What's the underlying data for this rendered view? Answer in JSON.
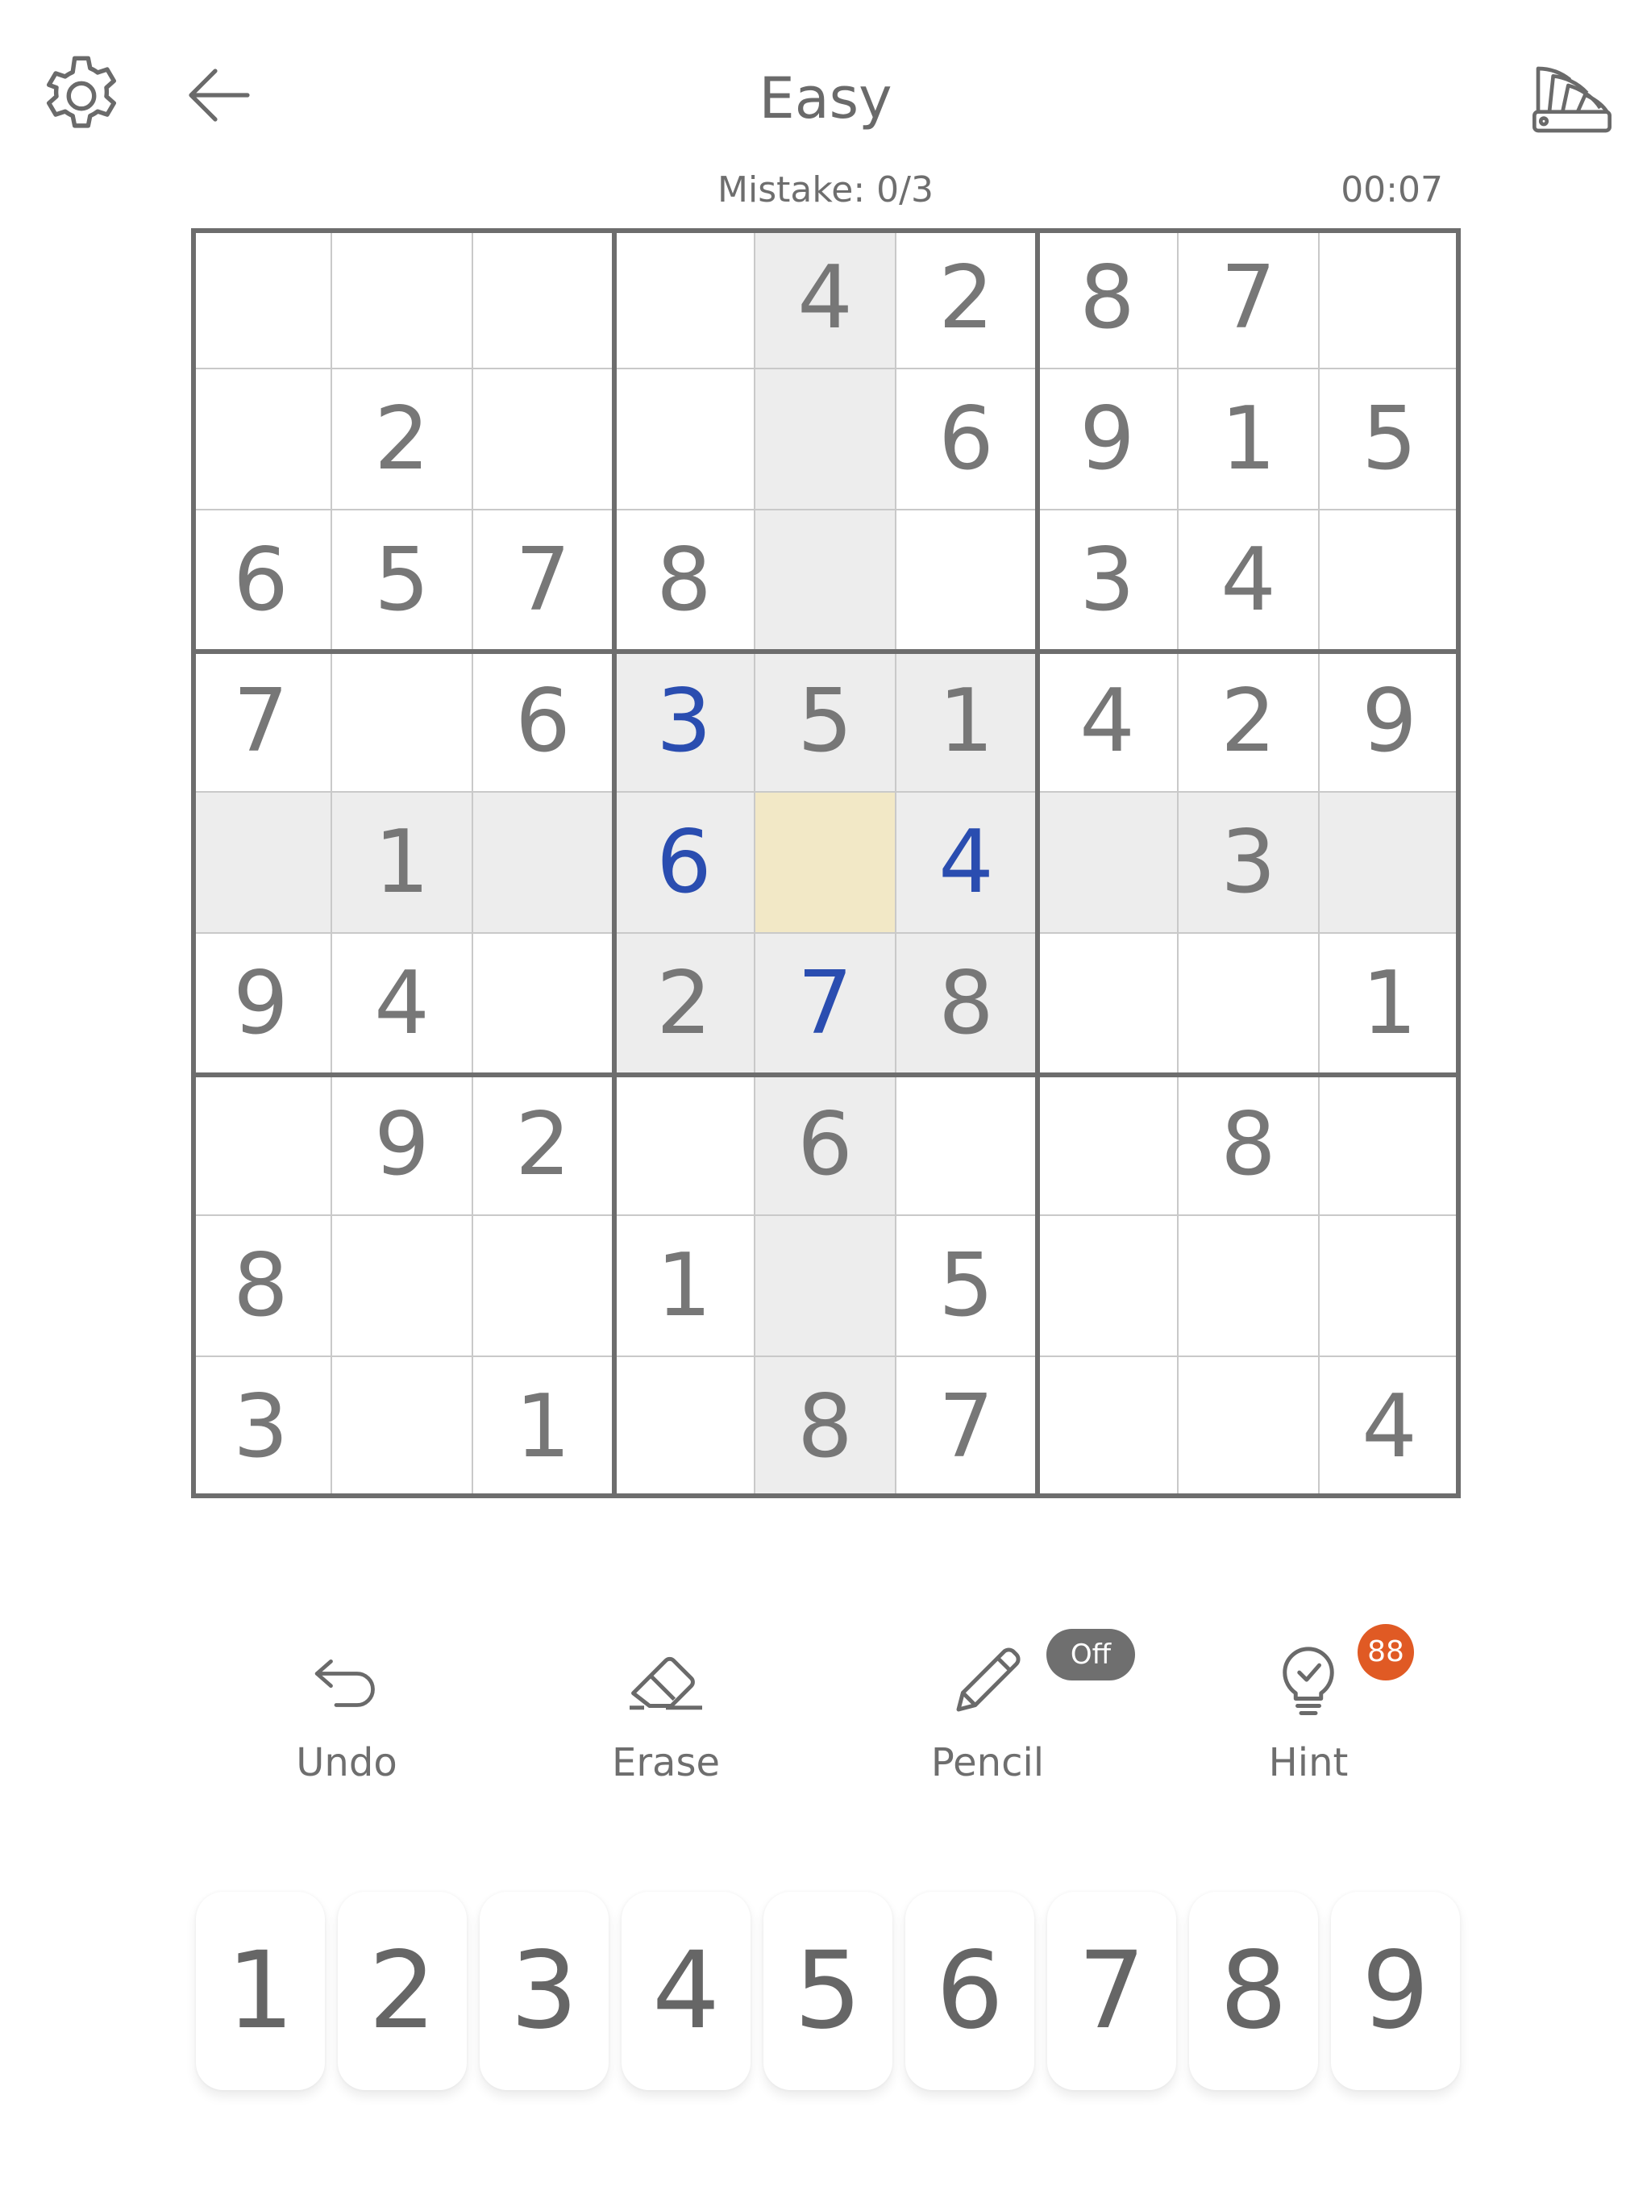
{
  "header": {
    "title": "Easy",
    "mistakes": "Mistake: 0/3",
    "timer": "00:07"
  },
  "board": {
    "rows": [
      [
        "",
        "",
        "",
        "",
        "4",
        "2",
        "8",
        "7",
        ""
      ],
      [
        "",
        "2",
        "",
        "",
        "",
        "6",
        "9",
        "1",
        "5"
      ],
      [
        "6",
        "5",
        "7",
        "8",
        "",
        "",
        "3",
        "4",
        ""
      ],
      [
        "7",
        "",
        "6",
        "3",
        "5",
        "1",
        "4",
        "2",
        "9"
      ],
      [
        "",
        "1",
        "",
        "6",
        "",
        "4",
        "",
        "3",
        ""
      ],
      [
        "9",
        "4",
        "",
        "2",
        "7",
        "8",
        "",
        "",
        "1"
      ],
      [
        "",
        "9",
        "2",
        "",
        "6",
        "",
        "",
        "8",
        ""
      ],
      [
        "8",
        "",
        "",
        "1",
        "",
        "5",
        "",
        "",
        ""
      ],
      [
        "3",
        "",
        "1",
        "",
        "8",
        "7",
        "",
        "",
        "4"
      ]
    ],
    "user_entries": [
      [
        3,
        3
      ],
      [
        4,
        3
      ],
      [
        4,
        5
      ],
      [
        5,
        4
      ]
    ],
    "selected": [
      4,
      4
    ],
    "colors": {
      "given": "#777777",
      "user": "#2a4db0",
      "highlight": "#ededed",
      "selected": "#f2e8c6"
    }
  },
  "tools": {
    "undo": "Undo",
    "erase": "Erase",
    "pencil": "Pencil",
    "pencil_state": "Off",
    "hint": "Hint",
    "hint_count": "88"
  },
  "numpad": [
    "1",
    "2",
    "3",
    "4",
    "5",
    "6",
    "7",
    "8",
    "9"
  ],
  "icons": {
    "settings": "gear-icon",
    "back": "arrow-left-icon",
    "theme": "palette-fan-icon",
    "undo": "undo-arrow-icon",
    "erase": "eraser-icon",
    "pencil": "pencil-icon",
    "hint": "lightbulb-icon"
  }
}
